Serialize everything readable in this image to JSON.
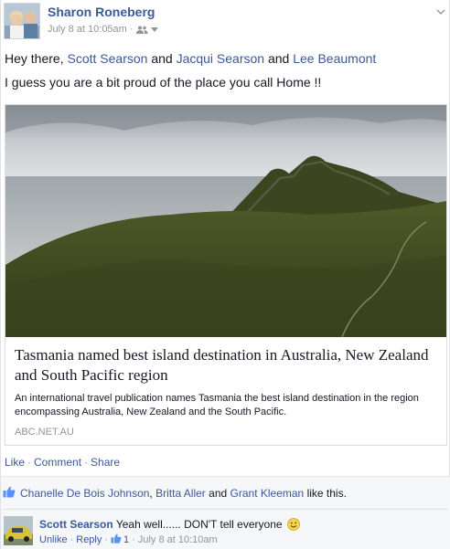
{
  "post": {
    "author": "Sharon Roneberg",
    "timestamp": "July 8 at 10:05am",
    "separator": "·",
    "audience_icon": "friends-icon",
    "message": {
      "greeting": "Hey there,",
      "tagged": [
        "Scott Searson",
        "Jacqui Searson",
        "Lee Beaumont"
      ],
      "conj1": "and",
      "conj2": "and",
      "line2": "I guess you are a bit proud of the place you call Home !!"
    }
  },
  "attachment": {
    "title": "Tasmania named best island destination in Australia, New Zealand and South Pacific region",
    "description": "An international travel publication names Tasmania the best island destination in the region encompassing Australia, New Zealand and the South Pacific.",
    "domain": "ABC.NET.AU"
  },
  "actions": {
    "like": "Like",
    "comment": "Comment",
    "share": "Share",
    "dot": "·"
  },
  "likes": {
    "names": [
      "Chanelle De Bois Johnson",
      "Britta Aller",
      "Grant Kleeman"
    ],
    "comma": ",",
    "and": "and",
    "suffix": "like this."
  },
  "comment": {
    "author": "Scott Searson",
    "text": "Yeah well...... DON'T tell everyone",
    "unlike": "Unlike",
    "reply": "Reply",
    "like_count": "1",
    "timestamp": "July 8 at 10:10am",
    "dot": "·"
  },
  "colors": {
    "link": "#3b5998",
    "meta": "#90949c",
    "text": "#141823",
    "feedback_bg": "#f6f7f8"
  }
}
